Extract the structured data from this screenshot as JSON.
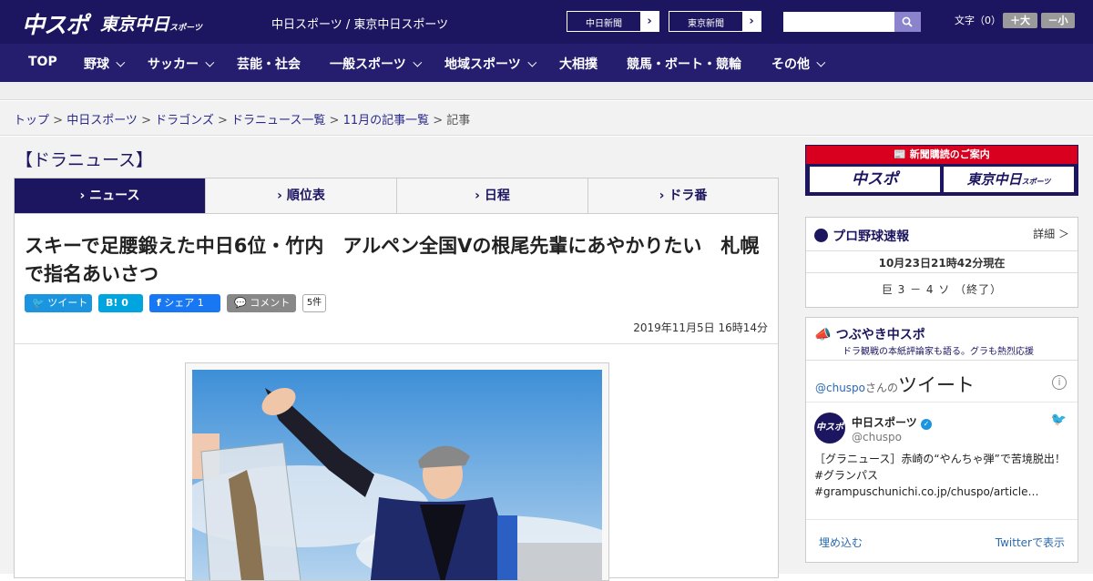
{
  "header": {
    "logo_chuspo": "中スポ",
    "logo_tokyo": "東京中日",
    "logo_tokyo_small": "スポーツ",
    "site_links": "中日スポーツ / 東京中日スポーツ",
    "btn_chunichi": "中日新聞",
    "btn_tokyo": "東京新聞",
    "search_placeholder": "",
    "font_size_label": "文字（0）",
    "font_plus": "＋大",
    "font_minus": "－小"
  },
  "nav": [
    "TOP",
    "野球",
    "サッカー",
    "芸能・社会",
    "一般スポーツ",
    "地域スポーツ",
    "大相撲",
    "競馬・ボート・競輪",
    "その他"
  ],
  "breadcrumb": {
    "items": [
      "トップ",
      "中日スポーツ",
      "ドラゴンズ",
      "ドラニュース一覧",
      "11月の記事一覧"
    ],
    "current": "記事"
  },
  "section_title": "【ドラニュース】",
  "tabs": [
    "ニュース",
    "順位表",
    "日程",
    "ドラ番"
  ],
  "article": {
    "title": "スキーで足腰鍛えた中日6位・竹内　アルペン全国Vの根尾先輩にあやかりたい　札幌で指名あいさつ",
    "share_tweet": "ツイート",
    "share_hatena": "B! 0",
    "share_fb": "シェア 1",
    "share_comment": "コメント",
    "comment_count": "5件",
    "date": "2019年11月5日 16時14分"
  },
  "sidebar": {
    "ad_title": "新聞購読のご案内",
    "ad_left": "中スポ",
    "ad_right": "東京中日",
    "ad_right_small": "スポーツ",
    "baseball_title": "プロ野球速報",
    "baseball_detail": "詳細 ＞",
    "baseball_time": "10月23日21時42分現在",
    "baseball_score": "巨 3 － 4 ソ （終了）",
    "tsubuyaki_title": "つぶやき中スポ",
    "tsubuyaki_sub": "ドラ観戦の本紙評論家も語る。グラも熱烈応援",
    "tw_handle_pre": "@chuspo",
    "tw_handle_mid": "さんの",
    "tw_label": "ツイート",
    "tw_name": "中日スポーツ",
    "tw_user": "@chuspo",
    "tw_text": "［グラニュース］赤崎の“やんちゃ弾”で苦境脱出！#グランパス #grampuschunichi.co.jp/chuspo/article…",
    "tw_text_hashtag": "#",
    "tw_embed": "埋め込む",
    "tw_view": "Twitterで表示"
  },
  "colors": {
    "brand": "#1c1660",
    "nav": "#251e6e",
    "ad_red": "#d8001e",
    "twitter": "#1b95e0",
    "facebook": "#1877f2",
    "hatena": "#00a4de"
  }
}
